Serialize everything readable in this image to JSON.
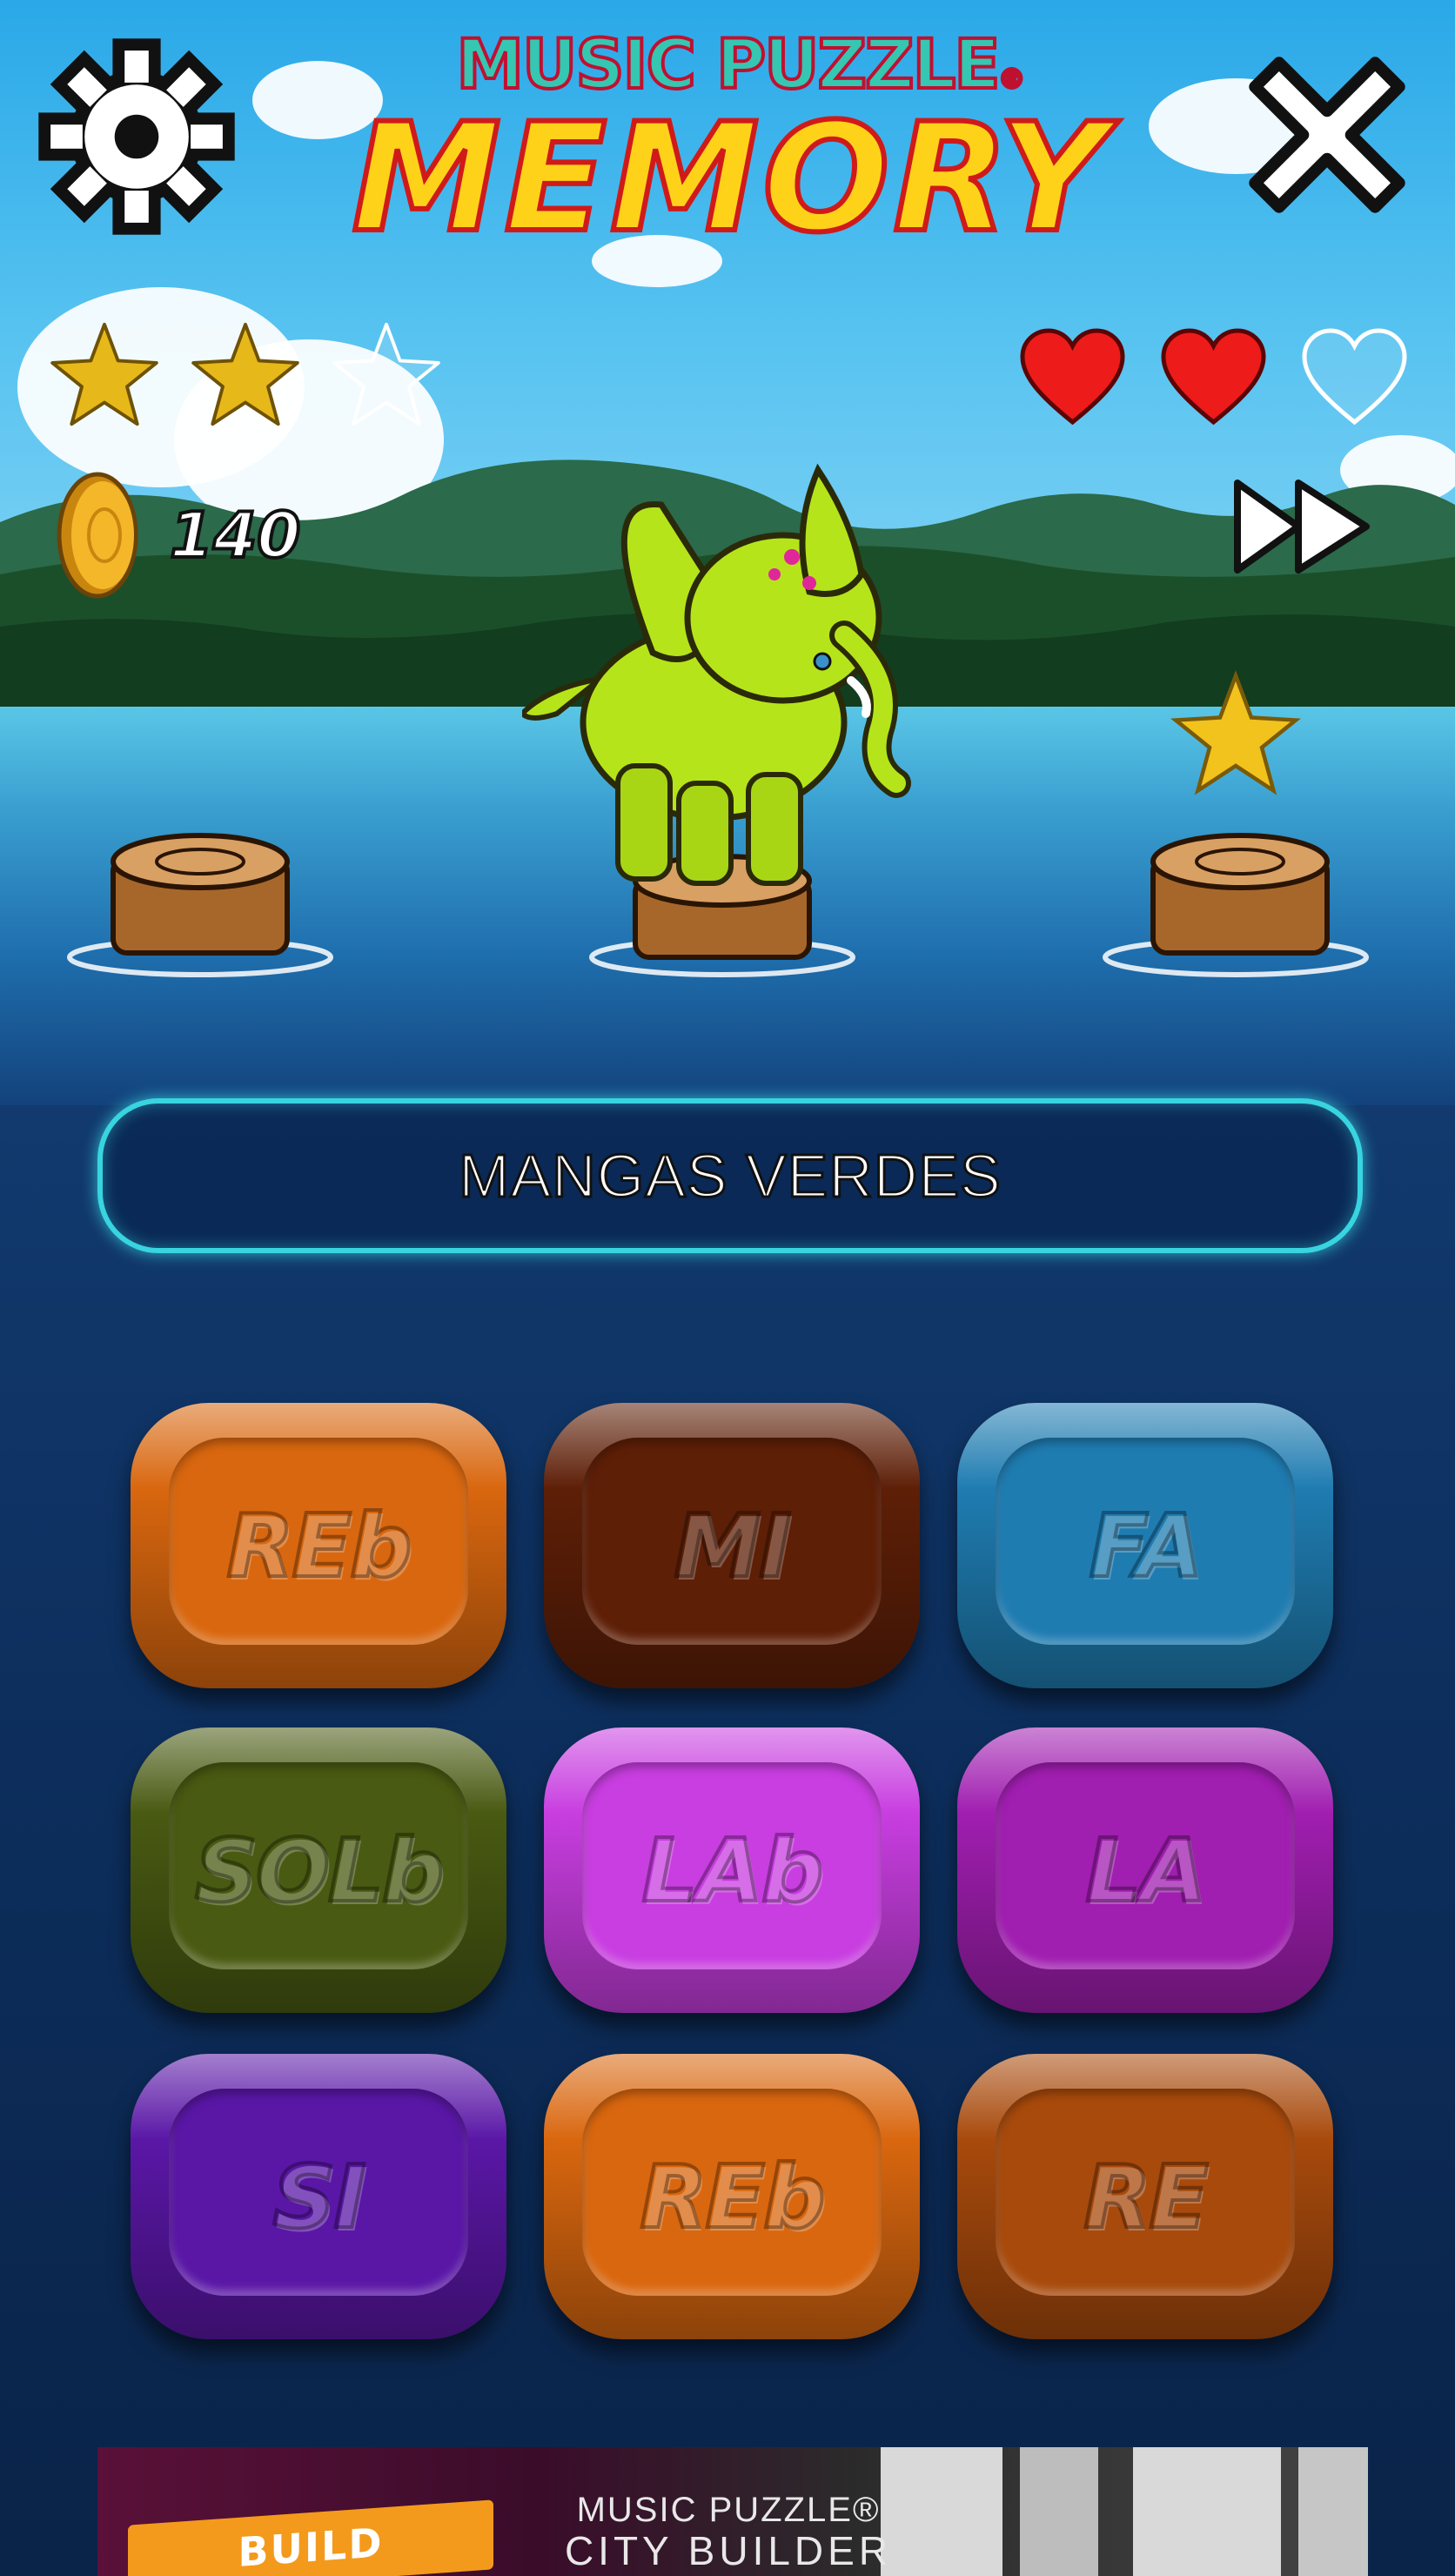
{
  "game": {
    "title_top": "MUSIC PUZZLE",
    "title_registered": "®",
    "title_main": "MEMORY"
  },
  "hud": {
    "settings_icon": "gear-icon",
    "close_icon": "close-icon",
    "skip_icon": "fast-forward-icon",
    "stars_earned": 2,
    "stars_total": 3,
    "lives_remaining": 2,
    "lives_total": 3,
    "coin_icon": "coin-icon",
    "coins": "140"
  },
  "scene": {
    "character": "green-elephant",
    "bonus_icon": "star-icon",
    "stumps": 3
  },
  "prompt": {
    "text": "MANGAS VERDES"
  },
  "tiles": [
    {
      "label": "REb",
      "color": "#d9670f"
    },
    {
      "label": "MI",
      "color": "#5e1f07"
    },
    {
      "label": "FA",
      "color": "#1f7cb1"
    },
    {
      "label": "SOLb",
      "color": "#495a12"
    },
    {
      "label": "LAb",
      "color": "#c83ee0"
    },
    {
      "label": "LA",
      "color": "#a01eb0"
    },
    {
      "label": "SI",
      "color": "#5a17a6"
    },
    {
      "label": "REb",
      "color": "#d9670f"
    },
    {
      "label": "RE",
      "color": "#a84a0c"
    }
  ],
  "banner": {
    "button": "BUILD",
    "line1": "MUSIC PUZZLE®",
    "line2": "CITY BUILDER"
  }
}
